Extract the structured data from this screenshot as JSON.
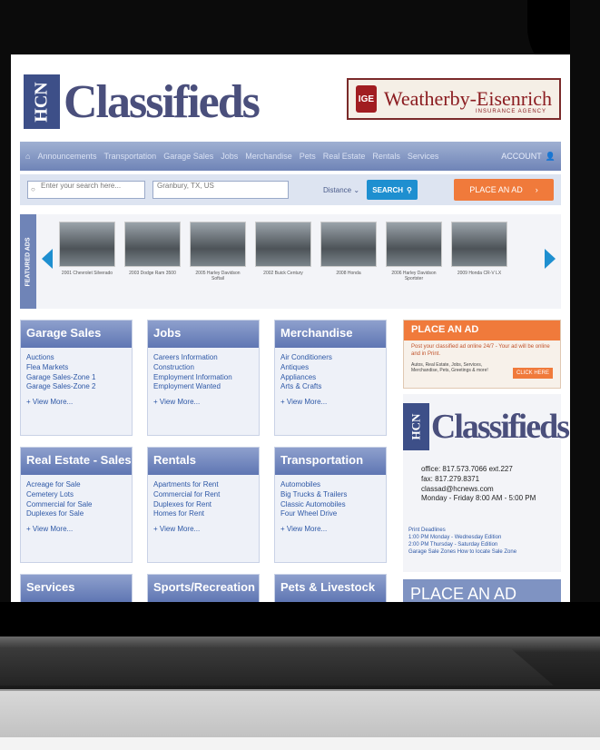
{
  "site": {
    "logo_mark": "HCN",
    "logo_text": "Classifieds",
    "sponsor": {
      "badge": "IGE",
      "name": "Weatherby-Eisenrich",
      "sub": "INSURANCE AGENCY"
    }
  },
  "nav": {
    "items": [
      "Announcements",
      "Transportation",
      "Garage Sales",
      "Jobs",
      "Merchandise",
      "Pets",
      "Real Estate",
      "Rentals",
      "Services"
    ],
    "account": "ACCOUNT"
  },
  "search": {
    "placeholder": "Enter your search here...",
    "location": "Granbury, TX, US",
    "distance": "Distance",
    "button": "SEARCH",
    "place_ad": "PLACE AN AD"
  },
  "featured": {
    "label": "FEATURED ADS",
    "items": [
      "2001 Chevrolet Silverado",
      "2003 Dodge Ram 3500",
      "2005 Harley Davidson Softail",
      "2002 Buick Century",
      "2008 Honda",
      "2006 Harley Davidson Sportster",
      "2009 Honda CR-V LX"
    ]
  },
  "categories": [
    {
      "title": "Garage Sales",
      "links": [
        "Auctions",
        "Flea Markets",
        "Garage Sales-Zone 1",
        "Garage Sales-Zone 2"
      ],
      "more": "+ View More..."
    },
    {
      "title": "Jobs",
      "links": [
        "Careers Information",
        "Construction",
        "Employment Information",
        "Employment Wanted"
      ],
      "more": "+ View More..."
    },
    {
      "title": "Merchandise",
      "links": [
        "Air Conditioners",
        "Antiques",
        "Appliances",
        "Arts & Crafts"
      ],
      "more": "+ View More..."
    },
    {
      "title": "Real Estate - Sales",
      "links": [
        "Acreage for Sale",
        "Cemetery Lots",
        "Commercial for Sale",
        "Duplexes for Sale"
      ],
      "more": "+ View More..."
    },
    {
      "title": "Rentals",
      "links": [
        "Apartments for Rent",
        "Commercial for Rent",
        "Duplexes for Rent",
        "Homes for Rent"
      ],
      "more": "+ View More..."
    },
    {
      "title": "Transportation",
      "links": [
        "Automobiles",
        "Big Trucks & Trailers",
        "Classic Automobiles",
        "Four Wheel Drive"
      ],
      "more": "+ View More..."
    },
    {
      "title": "Services",
      "links": [],
      "more": ""
    },
    {
      "title": "Sports/Recreation",
      "links": [],
      "more": ""
    },
    {
      "title": "Pets & Livestock",
      "links": [],
      "more": ""
    }
  ],
  "sidebar": {
    "place_ad_head": "PLACE AN AD",
    "place_ad_text": "Post your classified ad online 24/7 - Your ad will be online and in Print.",
    "place_ad_cats": "Autos, Real Estate, Jobs, Services, Merchandise, Pets, Greetings & more!",
    "place_ad_btn": "CLICK HERE",
    "contact": {
      "office": "office: 817.573.7066 ext.227",
      "fax": "fax: 817.279.8371",
      "email": "classad@hcnews.com",
      "hours": "Monday - Friday 8:00 AM - 5:00 PM"
    },
    "deadlines": [
      "Print Deadlines",
      "1:00 PM Monday - Wednesday Edition",
      "2:00 PM Thursday - Saturday Edition",
      "Garage Sale Zones How to locate Sale Zone"
    ],
    "place_ad_bottom": "PLACE AN AD"
  }
}
